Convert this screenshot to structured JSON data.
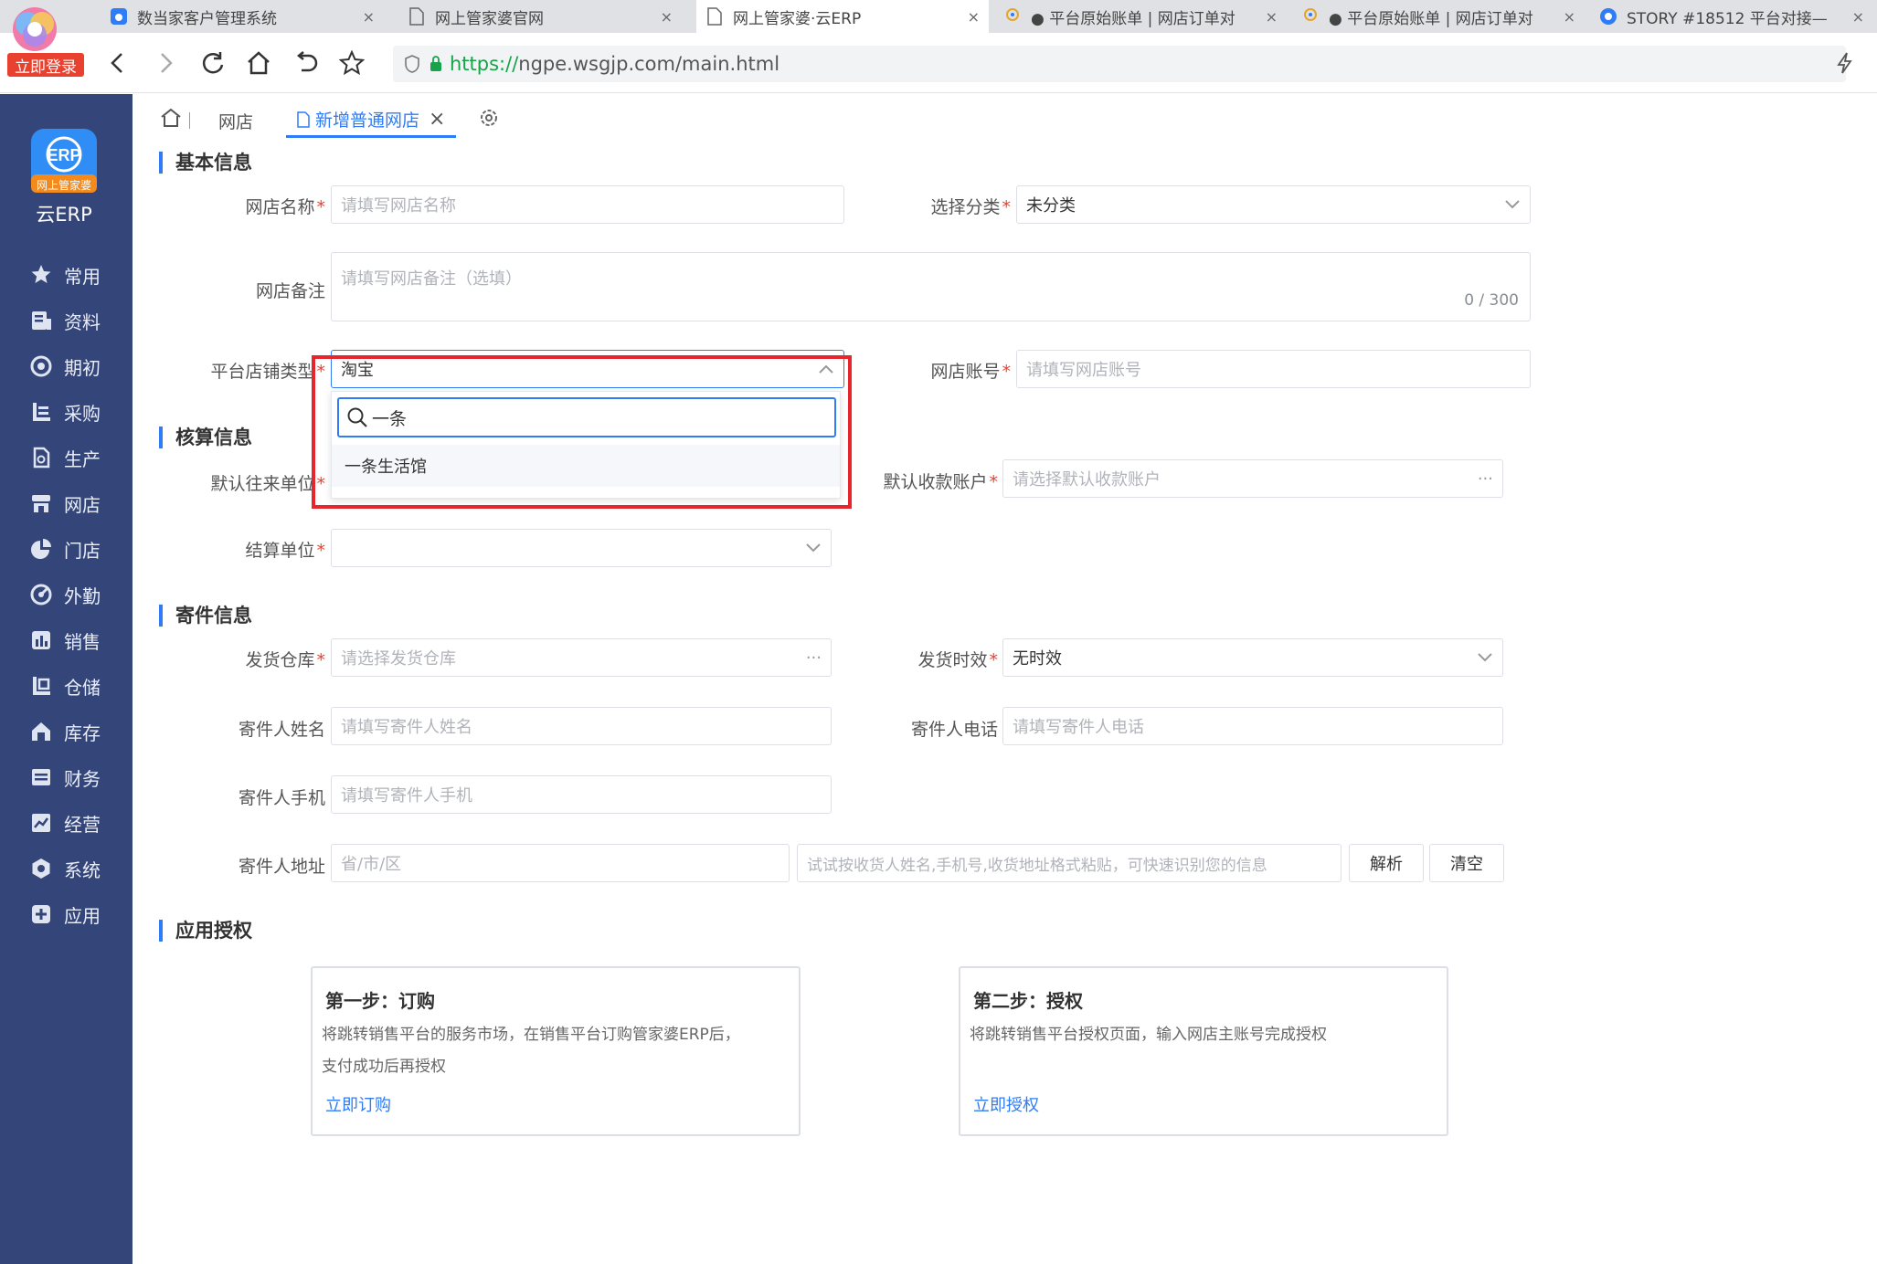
{
  "browser": {
    "tabs": [
      {
        "title": "数当家客户管理系统",
        "icon": "paw-icon"
      },
      {
        "title": "网上管家婆官网",
        "icon": "page-icon"
      },
      {
        "title": "网上管家婆·云ERP",
        "icon": "page-icon"
      },
      {
        "title": "● 平台原始账单 | 网店订单对",
        "icon": "app-icon"
      },
      {
        "title": "● 平台原始账单 | 网店订单对",
        "icon": "app-icon"
      },
      {
        "title": "STORY #18512 平台对接—",
        "icon": "swirl-icon"
      }
    ],
    "close_glyph": "×",
    "login_badge": "立即登录",
    "url_scheme": "https://",
    "url_rest": "ngpe.wsgjp.com/main.html"
  },
  "sidebar": {
    "logo_badge": "网上管家婆",
    "brand": "云ERP",
    "items": [
      {
        "label": "常用",
        "icon": "star-icon"
      },
      {
        "label": "资料",
        "icon": "profile-icon"
      },
      {
        "label": "期初",
        "icon": "target-icon"
      },
      {
        "label": "采购",
        "icon": "purchase-icon"
      },
      {
        "label": "生产",
        "icon": "production-icon"
      },
      {
        "label": "网店",
        "icon": "store-icon"
      },
      {
        "label": "门店",
        "icon": "pie-icon"
      },
      {
        "label": "外勤",
        "icon": "field-icon"
      },
      {
        "label": "销售",
        "icon": "bar-chart-icon"
      },
      {
        "label": "仓储",
        "icon": "warehouse-icon"
      },
      {
        "label": "库存",
        "icon": "inventory-icon"
      },
      {
        "label": "财务",
        "icon": "finance-icon"
      },
      {
        "label": "经营",
        "icon": "trend-icon"
      },
      {
        "label": "系统",
        "icon": "gear-icon"
      },
      {
        "label": "应用",
        "icon": "plus-icon"
      }
    ]
  },
  "tabs": {
    "store": "网店",
    "new_store": "新增普通网店",
    "close_glyph": "×"
  },
  "sections": {
    "basic": "基本信息",
    "accounting": "核算信息",
    "shipping": "寄件信息",
    "auth": "应用授权"
  },
  "form": {
    "req_mark": "*",
    "store_name": {
      "label": "网店名称",
      "placeholder": "请填写网店名称"
    },
    "category": {
      "label": "选择分类",
      "value": "未分类"
    },
    "remark": {
      "label": "网店备注",
      "placeholder": "请填写网店备注（选填）",
      "count": "0 / 300"
    },
    "platform": {
      "label": "平台店铺类型",
      "value": "淘宝"
    },
    "account": {
      "label": "网店账号",
      "placeholder": "请填写网店账号"
    },
    "default_partner": {
      "label": "默认往来单位"
    },
    "default_account": {
      "label": "默认收款账户",
      "placeholder": "请选择默认收款账户"
    },
    "settle_unit": {
      "label": "结算单位"
    },
    "warehouse": {
      "label": "发货仓库",
      "placeholder": "请选择发货仓库"
    },
    "timeliness": {
      "label": "发货时效",
      "value": "无时效"
    },
    "sender_name": {
      "label": "寄件人姓名",
      "placeholder": "请填写寄件人姓名"
    },
    "sender_phone": {
      "label": "寄件人电话",
      "placeholder": "请填写寄件人电话"
    },
    "sender_mobile": {
      "label": "寄件人手机",
      "placeholder": "请填写寄件人手机"
    },
    "sender_address": {
      "label": "寄件人地址",
      "region_placeholder": "省/市/区",
      "paste_placeholder": "试试按收货人姓名,手机号,收货地址格式粘贴，可快速识别您的信息"
    },
    "parse_btn": "解析",
    "clear_btn": "清空",
    "dots": "···"
  },
  "dropdown": {
    "search_value": "一条",
    "option": "一条生活馆"
  },
  "auth": {
    "step1": {
      "title": "第一步：订购",
      "line1": "将跳转销售平台的服务市场，在销售平台订购管家婆ERP后，",
      "line2": "支付成功后再授权",
      "link": "立即订购"
    },
    "step2": {
      "title": "第二步：授权",
      "line1": "将跳转销售平台授权页面，输入网店主账号完成授权",
      "link": "立即授权"
    }
  },
  "colors": {
    "accent": "#2f7cf6",
    "sidebar": "#34457a",
    "required": "#e8412f",
    "highlight": "#e6262c"
  }
}
